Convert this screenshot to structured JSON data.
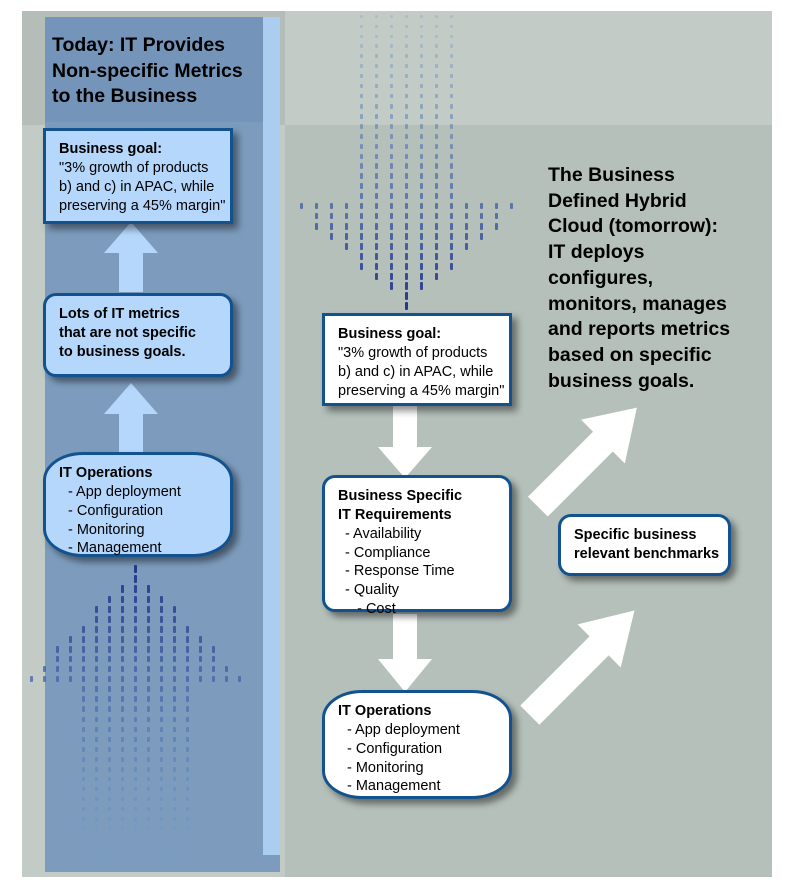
{
  "meta": {
    "kind": "concept-diagram",
    "colors": {
      "page_bg": "#ffffff",
      "canvas_bg": "#c3cbc6",
      "canvas_bg_alt": "#b5c0bb",
      "canvas_bg_top": "#b4bdb8",
      "left_column": "#7d9cbd",
      "left_column_top": "#7495b9",
      "left_column_stripe": "#aacdf0",
      "box_border": "#12538f",
      "box_fill_blue": "#b5d7fb",
      "box_fill_white": "#ffffff",
      "arrow_white": "#ffffff",
      "arrow_lightblue": "#b5d7fb",
      "dot_dark": "#26388c",
      "dot_light": "#6f9fd0"
    }
  },
  "left": {
    "title": "Today: IT Provides\nNon-specific Metrics\nto the Business",
    "business_goal": {
      "heading": "Business goal:",
      "lines": [
        "\"3% growth of products",
        "b) and c) in APAC, while",
        "preserving a 45% margin\""
      ]
    },
    "metrics": {
      "lines": [
        "Lots of IT metrics",
        "that are not specific",
        "to business goals."
      ]
    },
    "it_operations": {
      "heading": "IT Operations",
      "items": [
        "- App deployment",
        "- Configuration",
        "- Monitoring",
        "- Management"
      ]
    },
    "arrow_up_1": "up-arrow-metrics-to-goal",
    "arrow_up_2": "up-arrow-operations-to-metrics",
    "dotted_arrow_up": "dotted-up-arrow"
  },
  "center": {
    "dotted_arrow_down": "dotted-down-arrow",
    "business_goal": {
      "heading": "Business goal:",
      "lines": [
        "\"3% growth of products",
        "b) and c) in APAC, while",
        "preserving a 45% margin\""
      ]
    },
    "requirements": {
      "heading_line1": "Business Specific",
      "heading_line2": "IT Requirements",
      "items": [
        "- Availability",
        "- Compliance",
        "- Response Time",
        "- Quality",
        "   - Cost"
      ]
    },
    "it_operations": {
      "heading": "IT Operations",
      "items": [
        "- App deployment",
        "- Configuration",
        "- Monitoring",
        "- Management"
      ]
    },
    "arrow_goal_to_requirements": "down-arrow-goal-to-requirements",
    "arrow_requirements_to_operations": "down-arrow-requirements-to-operations"
  },
  "right": {
    "title": "The Business\nDefined Hybrid\nCloud (tomorrow):\nIT deploys\nconfigures,\nmonitors, manages\nand reports metrics\nbased on specific\nbusiness goals.",
    "benchmarks": {
      "lines": [
        "Specific business",
        "relevant benchmarks"
      ]
    },
    "arrow_benchmarks_to_goal": "diagonal-arrow-benchmarks-to-goal",
    "arrow_operations_to_benchmarks": "diagonal-arrow-operations-to-benchmarks"
  }
}
